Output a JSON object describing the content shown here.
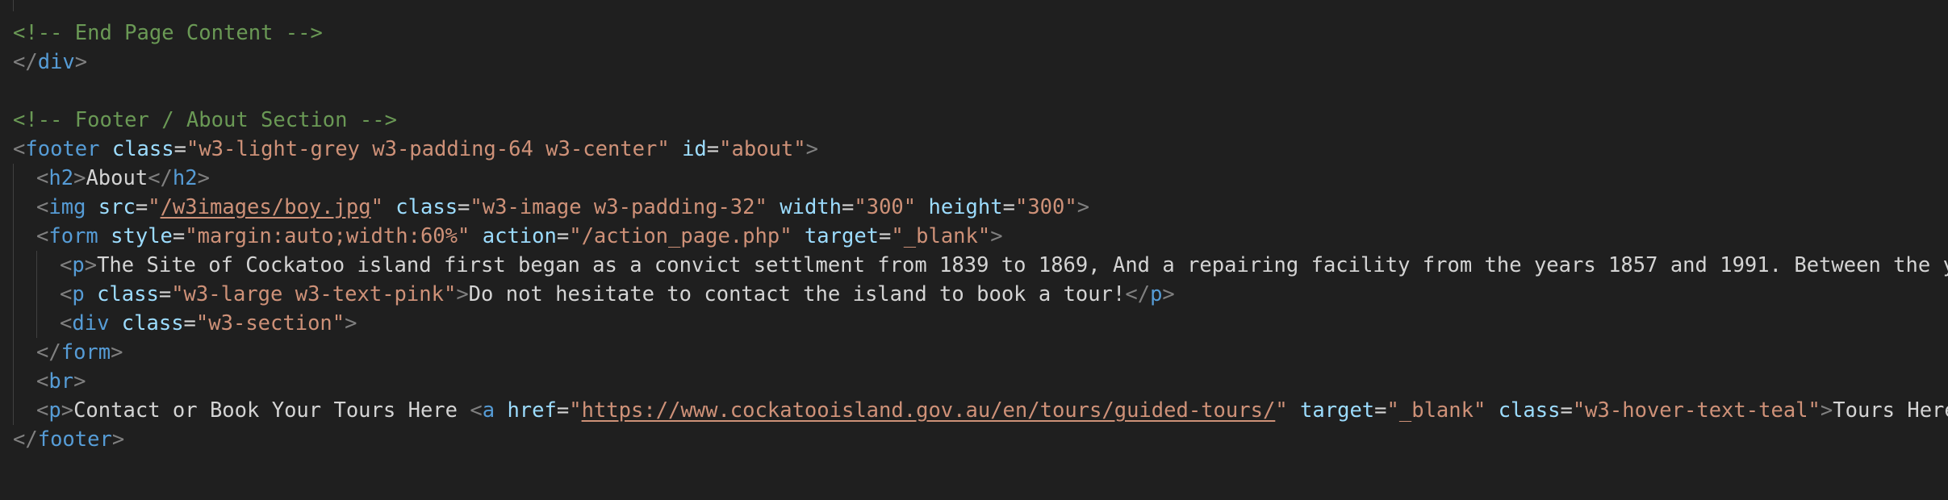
{
  "editor": {
    "language": "html",
    "colors": {
      "background": "#1f1f1f",
      "comment": "#6a9955",
      "tag": "#569cd6",
      "bracket": "#808080",
      "attribute": "#9cdcfe",
      "string": "#ce9178",
      "text": "#d4d4d4"
    },
    "lines": [
      {
        "indent": 0,
        "tokens": []
      },
      {
        "indent": 0,
        "tokens": [
          {
            "k": "cm",
            "t": "<!-- End Page Content -->"
          }
        ]
      },
      {
        "indent": 0,
        "tokens": [
          {
            "k": "br",
            "t": "</"
          },
          {
            "k": "tg",
            "t": "div"
          },
          {
            "k": "br",
            "t": ">"
          }
        ]
      },
      {
        "indent": 0,
        "tokens": []
      },
      {
        "indent": 0,
        "tokens": [
          {
            "k": "cm",
            "t": "<!-- Footer / About Section -->"
          }
        ]
      },
      {
        "indent": 0,
        "tokens": [
          {
            "k": "br",
            "t": "<"
          },
          {
            "k": "tg",
            "t": "footer"
          },
          {
            "k": "tx",
            "t": " "
          },
          {
            "k": "at",
            "t": "class"
          },
          {
            "k": "tx",
            "t": "="
          },
          {
            "k": "st",
            "t": "\"w3-light-grey w3-padding-64 w3-center\""
          },
          {
            "k": "tx",
            "t": " "
          },
          {
            "k": "at",
            "t": "id"
          },
          {
            "k": "tx",
            "t": "="
          },
          {
            "k": "st",
            "t": "\"about\""
          },
          {
            "k": "br",
            "t": ">"
          }
        ]
      },
      {
        "indent": 1,
        "tokens": [
          {
            "k": "br",
            "t": "<"
          },
          {
            "k": "tg",
            "t": "h2"
          },
          {
            "k": "br",
            "t": ">"
          },
          {
            "k": "tx",
            "t": "About"
          },
          {
            "k": "br",
            "t": "</"
          },
          {
            "k": "tg",
            "t": "h2"
          },
          {
            "k": "br",
            "t": ">"
          }
        ]
      },
      {
        "indent": 1,
        "tokens": [
          {
            "k": "br",
            "t": "<"
          },
          {
            "k": "tg",
            "t": "img"
          },
          {
            "k": "tx",
            "t": " "
          },
          {
            "k": "at",
            "t": "src"
          },
          {
            "k": "tx",
            "t": "="
          },
          {
            "k": "st",
            "t": "\""
          },
          {
            "k": "st",
            "t": "/w3images/boy.jpg",
            "u": true
          },
          {
            "k": "st",
            "t": "\""
          },
          {
            "k": "tx",
            "t": " "
          },
          {
            "k": "at",
            "t": "class"
          },
          {
            "k": "tx",
            "t": "="
          },
          {
            "k": "st",
            "t": "\"w3-image w3-padding-32\""
          },
          {
            "k": "tx",
            "t": " "
          },
          {
            "k": "at",
            "t": "width"
          },
          {
            "k": "tx",
            "t": "="
          },
          {
            "k": "st",
            "t": "\"300\""
          },
          {
            "k": "tx",
            "t": " "
          },
          {
            "k": "at",
            "t": "height"
          },
          {
            "k": "tx",
            "t": "="
          },
          {
            "k": "st",
            "t": "\"300\""
          },
          {
            "k": "br",
            "t": ">"
          }
        ]
      },
      {
        "indent": 1,
        "tokens": [
          {
            "k": "br",
            "t": "<"
          },
          {
            "k": "tg",
            "t": "form"
          },
          {
            "k": "tx",
            "t": " "
          },
          {
            "k": "at",
            "t": "style"
          },
          {
            "k": "tx",
            "t": "="
          },
          {
            "k": "st",
            "t": "\"margin:auto;width:60%\""
          },
          {
            "k": "tx",
            "t": " "
          },
          {
            "k": "at",
            "t": "action"
          },
          {
            "k": "tx",
            "t": "="
          },
          {
            "k": "st",
            "t": "\"/action_page.php\""
          },
          {
            "k": "tx",
            "t": " "
          },
          {
            "k": "at",
            "t": "target"
          },
          {
            "k": "tx",
            "t": "="
          },
          {
            "k": "st",
            "t": "\"_blank\""
          },
          {
            "k": "br",
            "t": ">"
          }
        ]
      },
      {
        "indent": 2,
        "tokens": [
          {
            "k": "br",
            "t": "<"
          },
          {
            "k": "tg",
            "t": "p"
          },
          {
            "k": "br",
            "t": ">"
          },
          {
            "k": "tx",
            "t": "The Site of Cockatoo island first began as a convict settlment from 1839 to 1869, And a repairing facility from the years 1857 and 1991. Between the years of"
          }
        ]
      },
      {
        "indent": 2,
        "tokens": [
          {
            "k": "br",
            "t": "<"
          },
          {
            "k": "tg",
            "t": "p"
          },
          {
            "k": "tx",
            "t": " "
          },
          {
            "k": "at",
            "t": "class"
          },
          {
            "k": "tx",
            "t": "="
          },
          {
            "k": "st",
            "t": "\"w3-large w3-text-pink\""
          },
          {
            "k": "br",
            "t": ">"
          },
          {
            "k": "tx",
            "t": "Do not hesitate to contact the island to book a tour!"
          },
          {
            "k": "br",
            "t": "</"
          },
          {
            "k": "tg",
            "t": "p"
          },
          {
            "k": "br",
            "t": ">"
          }
        ]
      },
      {
        "indent": 2,
        "tokens": [
          {
            "k": "br",
            "t": "<"
          },
          {
            "k": "tg",
            "t": "div"
          },
          {
            "k": "tx",
            "t": " "
          },
          {
            "k": "at",
            "t": "class"
          },
          {
            "k": "tx",
            "t": "="
          },
          {
            "k": "st",
            "t": "\"w3-section\""
          },
          {
            "k": "br",
            "t": ">"
          }
        ]
      },
      {
        "indent": 1,
        "tokens": [
          {
            "k": "br",
            "t": "</"
          },
          {
            "k": "tg",
            "t": "form"
          },
          {
            "k": "br",
            "t": ">"
          }
        ]
      },
      {
        "indent": 1,
        "tokens": [
          {
            "k": "br",
            "t": "<"
          },
          {
            "k": "tg",
            "t": "br"
          },
          {
            "k": "br",
            "t": ">"
          }
        ]
      },
      {
        "indent": 1,
        "tokens": [
          {
            "k": "br",
            "t": "<"
          },
          {
            "k": "tg",
            "t": "p"
          },
          {
            "k": "br",
            "t": ">"
          },
          {
            "k": "tx",
            "t": "Contact or Book Your Tours Here "
          },
          {
            "k": "br",
            "t": "<"
          },
          {
            "k": "tg",
            "t": "a"
          },
          {
            "k": "tx",
            "t": " "
          },
          {
            "k": "at",
            "t": "href"
          },
          {
            "k": "tx",
            "t": "="
          },
          {
            "k": "st",
            "t": "\""
          },
          {
            "k": "st",
            "t": "https://www.cockatooisland.gov.au/en/tours/guided-tours/",
            "u": true
          },
          {
            "k": "st",
            "t": "\""
          },
          {
            "k": "tx",
            "t": " "
          },
          {
            "k": "at",
            "t": "target"
          },
          {
            "k": "tx",
            "t": "="
          },
          {
            "k": "st",
            "t": "\"_blank\""
          },
          {
            "k": "tx",
            "t": " "
          },
          {
            "k": "at",
            "t": "class"
          },
          {
            "k": "tx",
            "t": "="
          },
          {
            "k": "st",
            "t": "\"w3-hover-text-teal\""
          },
          {
            "k": "br",
            "t": ">"
          },
          {
            "k": "tx",
            "t": "Tours Here!"
          },
          {
            "k": "br",
            "t": "</"
          },
          {
            "k": "tg",
            "t": "a"
          },
          {
            "k": "br",
            "t": "></"
          },
          {
            "k": "tg",
            "t": "p"
          }
        ]
      },
      {
        "indent": 0,
        "tokens": [
          {
            "k": "br",
            "t": "</"
          },
          {
            "k": "tg",
            "t": "footer"
          },
          {
            "k": "br",
            "t": ">"
          }
        ]
      },
      {
        "indent": 0,
        "tokens": []
      }
    ]
  }
}
